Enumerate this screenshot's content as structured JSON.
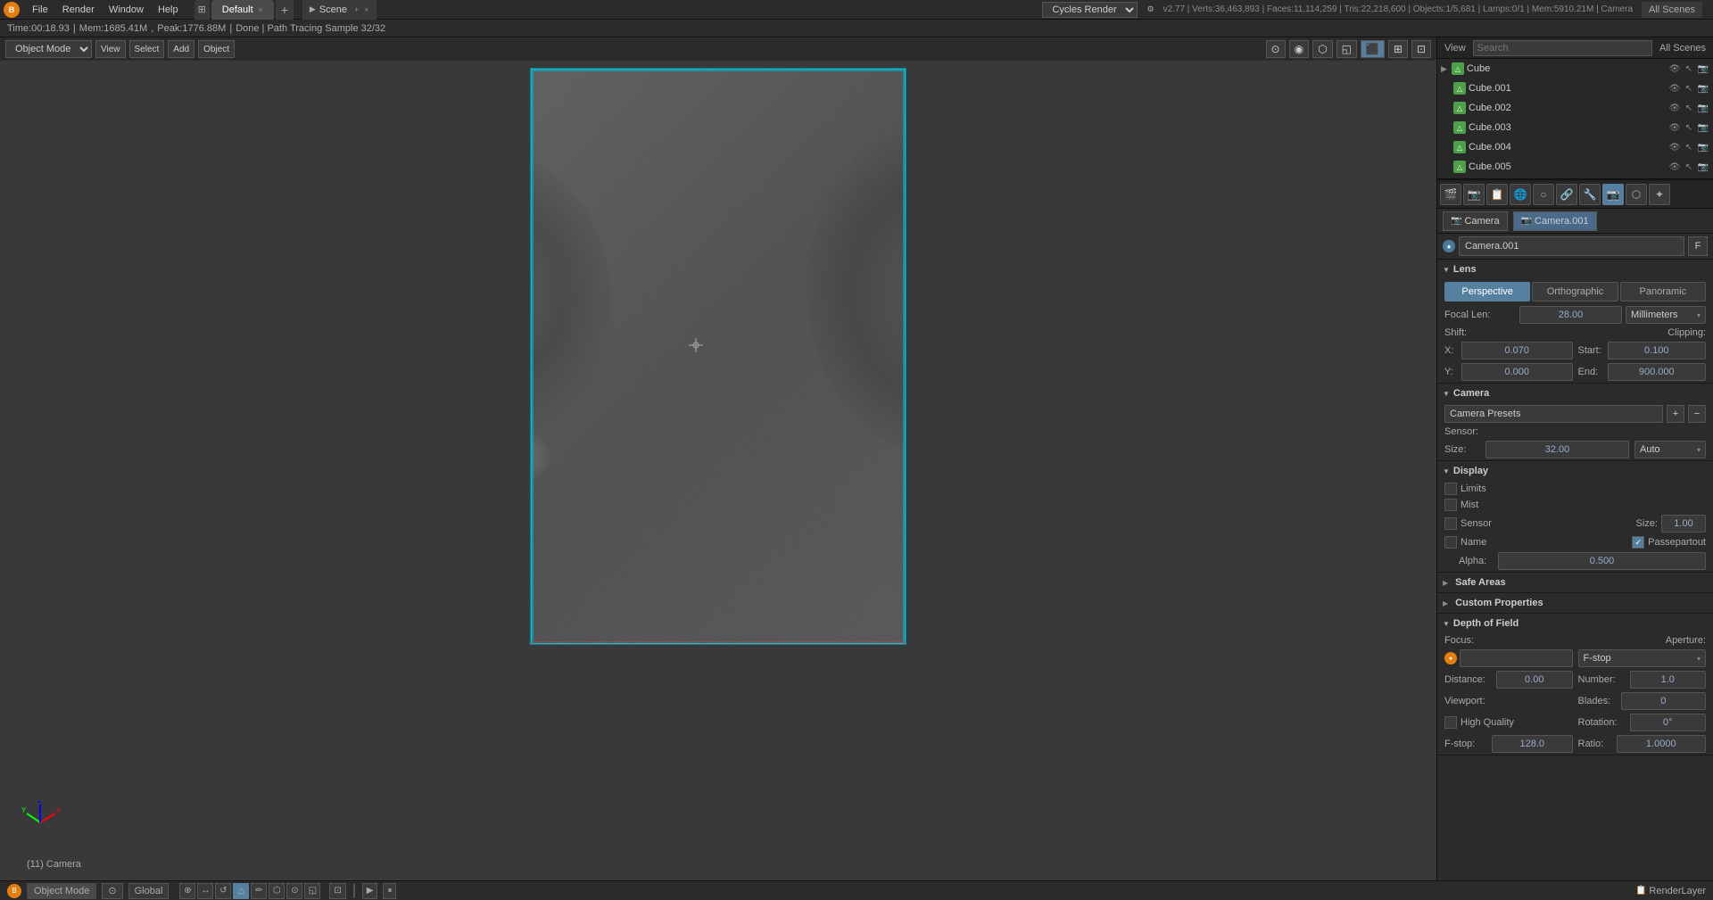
{
  "app": {
    "logo": "B",
    "version": "v2.77",
    "stats": "v2.77 | Verts:36,463,893 | Faces:11,114,259 | Tris:22,218,600 | Objects:1/5,681 | Lamps:0/1 | Mem:5910.21M | Camera"
  },
  "topbar": {
    "menus": [
      "File",
      "Render",
      "Window",
      "Help"
    ],
    "layout_icon": "⊞",
    "workspace": "Default",
    "workspace_add": "+",
    "workspace_close": "×",
    "scene_icon": "▶",
    "scene_label": "Scene",
    "scene_add": "+",
    "scene_close": "×",
    "engine": "Cycles Render",
    "engine_arrow": "▾",
    "scenes": "All Scenes"
  },
  "infobar": {
    "time": "Time:00:18.93",
    "mem": "Mem:1685.41M",
    "peak": "Peak:1776.88M",
    "status": "Done | Path Tracing Sample 32/32"
  },
  "viewport": {
    "mode": "Object Mode",
    "camera_label": "(11) Camera"
  },
  "outliner": {
    "title": "View",
    "search_placeholder": "Search",
    "scenes": "All Scenes",
    "items": [
      {
        "id": "cube_root",
        "label": "Cube",
        "type": "mesh",
        "indent": 0,
        "expanded": true
      },
      {
        "id": "cube_001",
        "label": "Cube.001",
        "type": "mesh",
        "indent": 1
      },
      {
        "id": "cube_002",
        "label": "Cube.002",
        "type": "mesh",
        "indent": 1
      },
      {
        "id": "cube_003",
        "label": "Cube.003",
        "type": "mesh",
        "indent": 1
      },
      {
        "id": "cube_004",
        "label": "Cube.004",
        "type": "mesh",
        "indent": 1
      },
      {
        "id": "cube_005",
        "label": "Cube.005",
        "type": "mesh",
        "indent": 1
      }
    ]
  },
  "properties": {
    "active_tab": "camera",
    "object_type": "Camera",
    "active_object": "Camera.001",
    "linked_object": "Camera.001",
    "f_key": "F",
    "sections": {
      "lens": {
        "title": "Lens",
        "tabs": [
          "Perspective",
          "Orthographic",
          "Panoramic"
        ],
        "active_tab": "Perspective",
        "focal_len_label": "Focal Len:",
        "focal_len_value": "28.00",
        "unit_label": "Millimeters",
        "shift_label": "Shift:",
        "clipping_label": "Clipping:",
        "x_label": "X:",
        "x_value": "0.070",
        "y_label": "Y:",
        "y_value": "0.000",
        "start_label": "Start:",
        "start_value": "0.100",
        "end_label": "End:",
        "end_value": "900.000"
      },
      "camera": {
        "title": "Camera",
        "camera_presets_label": "Camera Presets",
        "sensor_label": "Sensor:",
        "size_label": "Size:",
        "size_value": "32.00",
        "size_unit": "Auto"
      },
      "display": {
        "title": "Display",
        "limits_label": "Limits",
        "mist_label": "Mist",
        "sensor_label": "Sensor",
        "name_label": "Name",
        "size_label": "Size:",
        "size_value": "1.00",
        "passepartout_label": "Passepartout",
        "alpha_label": "Alpha:",
        "alpha_value": "0.500"
      },
      "safe_areas": {
        "title": "Safe Areas",
        "collapsed": true
      },
      "custom_properties": {
        "title": "Custom Properties",
        "collapsed": true
      },
      "dof": {
        "title": "Depth of Field",
        "focus_label": "Focus:",
        "aperture_label": "Aperture:",
        "focus_value": "",
        "aperture_type": "F-stop",
        "distance_label": "Distance:",
        "distance_value": "0.00",
        "number_label": "Number:",
        "number_value": "1.0",
        "viewport_label": "Viewport:",
        "blades_label": "Blades:",
        "blades_value": "0",
        "high_quality_label": "High Quality",
        "rotation_label": "Rotation:",
        "rotation_value": "0°",
        "fstop_label": "F-stop:",
        "fstop_value": "128.0",
        "ratio_label": "Ratio:",
        "ratio_value": "1.0000"
      }
    }
  },
  "bottom_bar": {
    "mode": "Object Mode",
    "pivot": "⊙",
    "transform": "Global",
    "render_layer": "RenderLayer"
  }
}
